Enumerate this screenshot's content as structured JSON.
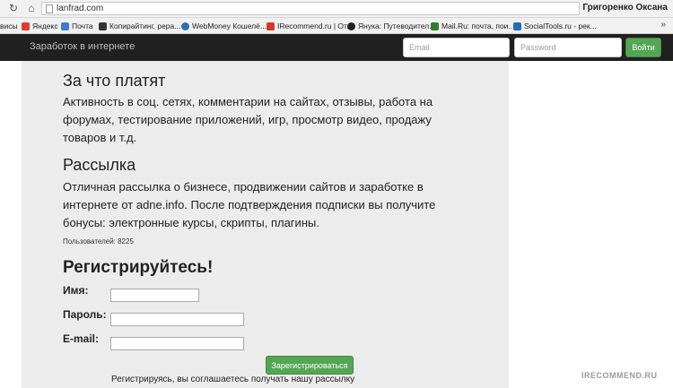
{
  "browser": {
    "url": "lanfrad.com",
    "user_name": "Григоренко Оксана",
    "bookmarks": [
      {
        "label": "висы",
        "icon": "none",
        "color": "#f1f1f1"
      },
      {
        "label": "Яндекс",
        "icon": "yandex-icon",
        "color": "#e23b2e"
      },
      {
        "label": "Почта",
        "icon": "mail-icon",
        "color": "#3b7bd6"
      },
      {
        "label": "Копирайтинг, рера...",
        "icon": "letter-a-icon",
        "color": "#333333"
      },
      {
        "label": "WebMoney Кошелё...",
        "icon": "webmoney-icon",
        "color": "#2f6fb8"
      },
      {
        "label": "IRecommend.ru | От...",
        "icon": "irecommend-icon",
        "color": "#d23a2a"
      },
      {
        "label": "Янука: Путеводител...",
        "icon": "github-icon",
        "color": "#222222"
      },
      {
        "label": "Mail.Ru: почта, пои...",
        "icon": "mailru-icon",
        "color": "#2e7d32"
      },
      {
        "label": "SocialTools.ru - рек...",
        "icon": "socialtools-icon",
        "color": "#1f6fb5"
      }
    ],
    "bookmarks_more": "»"
  },
  "navbar": {
    "brand": "Заработок в интернете",
    "email_placeholder": "Email",
    "password_placeholder": "Password",
    "login_label": "Войти"
  },
  "content": {
    "section1_title": "За что платят",
    "section1_lines": [
      "Активность в соц. сетях, комментарии на сайтах, отзывы, работа на",
      "форумах, тестирование приложений, игр, просмотр видео, продажу",
      "товаров и т.д."
    ],
    "section2_title": "Рассылка",
    "section2_lines": [
      "Отличная рассылка о бизнесе, продвижении сайтов и заработке в",
      "интернете от adne.info. После подтверждения подписки вы получите",
      "бонусы: электронные курсы, скрипты, плагины."
    ],
    "users_count": "Пользователей: 8225",
    "register_title": "Регистрируйтесь!",
    "name_label": "Имя:",
    "name_value": "",
    "password_label": "Пароль:",
    "password_value": "",
    "email_label": "E-mail:",
    "email_value": "",
    "submit_label": "Зарегистрироваться",
    "agreement_text": "Регистрируясь, вы соглашаетесь получать нашу рассылку"
  },
  "watermark": "IRECOMMEND.RU",
  "colors": {
    "navbar_bg": "#202020",
    "button_green": "#54a654",
    "panel_bg": "#ececec"
  }
}
